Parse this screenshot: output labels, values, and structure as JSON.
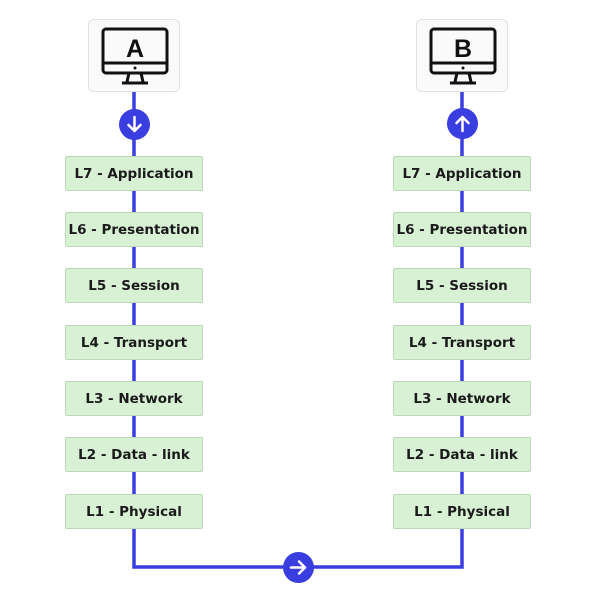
{
  "colors": {
    "line": "#3a3de0",
    "layer_fill": "#d8f1d5",
    "layer_border": "#bcd9b8"
  },
  "hosts": [
    {
      "label": "A",
      "icon": "monitor-icon"
    },
    {
      "label": "B",
      "icon": "monitor-icon"
    }
  ],
  "left_layers": [
    "L7 - Application",
    "L6 - Presentation",
    "L5 - Session",
    "L4 - Transport",
    "L3 - Network",
    "L2 - Data - link",
    "L1 - Physical"
  ],
  "right_layers": [
    "L7 - Application",
    "L6 - Presentation",
    "L5 - Session",
    "L4 - Transport",
    "L3 - Network",
    "L2 - Data - link",
    "L1 - Physical"
  ],
  "arrows": {
    "left": "arrow-down-icon",
    "right": "arrow-up-icon",
    "bottom": "arrow-right-icon"
  }
}
